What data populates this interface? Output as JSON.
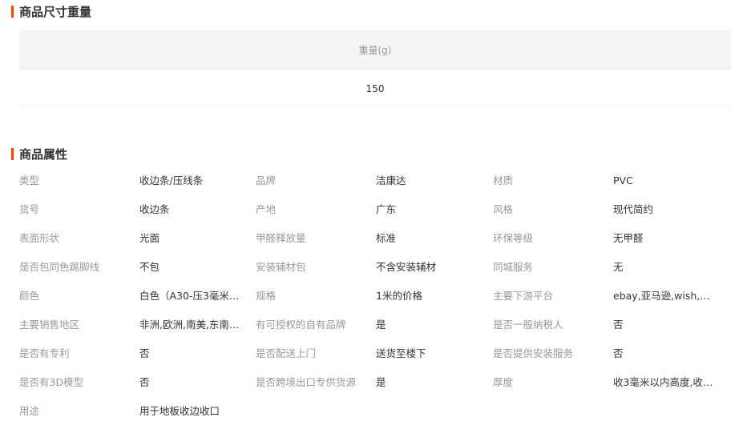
{
  "size_weight": {
    "title": "商品尺寸重量",
    "header": "重量(g)",
    "value": "150"
  },
  "attributes": {
    "title": "商品属性",
    "rows": [
      [
        [
          "类型",
          "收边条/压线条"
        ],
        [
          "品牌",
          "洁康达"
        ],
        [
          "材质",
          "PVC"
        ]
      ],
      [
        [
          "货号",
          "收边条"
        ],
        [
          "产地",
          "广东"
        ],
        [
          "风格",
          "现代简约"
        ]
      ],
      [
        [
          "表面形状",
          "光面"
        ],
        [
          "甲醛释放量",
          "标准"
        ],
        [
          "环保等级",
          "无甲醛"
        ]
      ],
      [
        [
          "是否包同色踢脚线",
          "不包"
        ],
        [
          "安装辅材包",
          "不含安装辅材"
        ],
        [
          "同城服务",
          "无"
        ]
      ],
      [
        [
          "颜色",
          "白色（A30-压3毫米边…"
        ],
        [
          "规格",
          "1米的价格"
        ],
        [
          "主要下游平台",
          "ebay,亚马逊,wish,速…"
        ]
      ],
      [
        [
          "主要销售地区",
          "非洲,欧洲,南美,东南…"
        ],
        [
          "有可授权的自有品牌",
          "是"
        ],
        [
          "是否一般纳税人",
          "否"
        ]
      ],
      [
        [
          "是否有专利",
          "否"
        ],
        [
          "是否配送上门",
          "送货至楼下"
        ],
        [
          "是否提供安装服务",
          "否"
        ]
      ],
      [
        [
          "是否有3D模型",
          "否"
        ],
        [
          "是否跨境出口专供货源",
          "是"
        ],
        [
          "厚度",
          "收3毫米以内高度,收5…"
        ]
      ],
      [
        [
          "用途",
          "用于地板收边收口"
        ]
      ]
    ]
  }
}
